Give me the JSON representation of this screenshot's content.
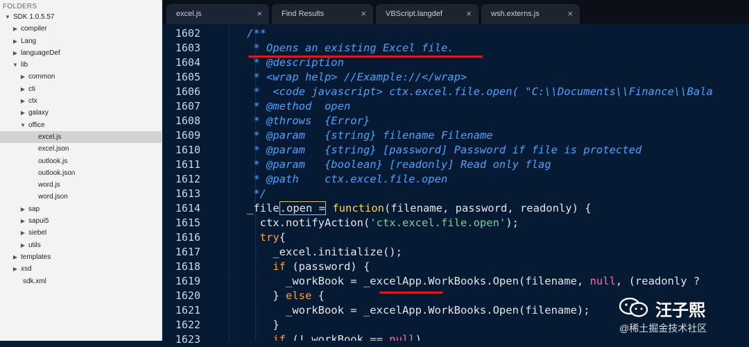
{
  "sidebar": {
    "header": "FOLDERS",
    "items": [
      {
        "label": "SDK 1.0.5.57",
        "arrow": "▼",
        "depth": 0
      },
      {
        "label": "compiler",
        "arrow": "▶",
        "depth": 1
      },
      {
        "label": "Lang",
        "arrow": "▶",
        "depth": 1
      },
      {
        "label": "languageDef",
        "arrow": "▶",
        "depth": 1
      },
      {
        "label": "lib",
        "arrow": "▼",
        "depth": 1
      },
      {
        "label": "common",
        "arrow": "▶",
        "depth": 2
      },
      {
        "label": "cti",
        "arrow": "▶",
        "depth": 2
      },
      {
        "label": "ctx",
        "arrow": "▶",
        "depth": 2
      },
      {
        "label": "galaxy",
        "arrow": "▶",
        "depth": 2
      },
      {
        "label": "office",
        "arrow": "▼",
        "depth": 2
      },
      {
        "label": "excel.js",
        "arrow": "",
        "depth": 3,
        "selected": true
      },
      {
        "label": "excel.json",
        "arrow": "",
        "depth": 3
      },
      {
        "label": "outlook.js",
        "arrow": "",
        "depth": 3
      },
      {
        "label": "outlook.json",
        "arrow": "",
        "depth": 3
      },
      {
        "label": "word.js",
        "arrow": "",
        "depth": 3
      },
      {
        "label": "word.json",
        "arrow": "",
        "depth": 3
      },
      {
        "label": "sap",
        "arrow": "▶",
        "depth": 2
      },
      {
        "label": "sapui5",
        "arrow": "▶",
        "depth": 2
      },
      {
        "label": "siebel",
        "arrow": "▶",
        "depth": 2
      },
      {
        "label": "utils",
        "arrow": "▶",
        "depth": 2
      },
      {
        "label": "templates",
        "arrow": "▶",
        "depth": 1
      },
      {
        "label": "xsd",
        "arrow": "▶",
        "depth": 1
      },
      {
        "label": "sdk.xml",
        "arrow": "",
        "depth": 1
      }
    ]
  },
  "tabs": [
    {
      "label": "excel.js",
      "close": "×"
    },
    {
      "label": "Find Results",
      "close": "×"
    },
    {
      "label": "VBScript.langdef",
      "close": "×"
    },
    {
      "label": "wsh.externs.js",
      "close": "×"
    }
  ],
  "line_numbers": [
    "1602",
    "1603",
    "1604",
    "1605",
    "1606",
    "1607",
    "1608",
    "1609",
    "1610",
    "1611",
    "1612",
    "1613",
    "1614",
    "1615",
    "1616",
    "1617",
    "1618",
    "1619",
    "1620",
    "1621",
    "1622",
    "1623"
  ],
  "code_lines": [
    [
      [
        "c",
        "      /**"
      ]
    ],
    [
      [
        "c",
        "       * Opens an existing Excel file."
      ]
    ],
    [
      [
        "c",
        "       * @description"
      ]
    ],
    [
      [
        "c",
        "       * <wrap help> //Example://</wrap>"
      ]
    ],
    [
      [
        "c",
        "       *  <code javascript> ctx.excel.file.open( \"C:\\\\Documents\\\\Finance\\\\Bala"
      ]
    ],
    [
      [
        "c",
        "       * @method  open"
      ]
    ],
    [
      [
        "c",
        "       * @throws  {Error}"
      ]
    ],
    [
      [
        "c",
        "       * @param   {string} filename Filename"
      ]
    ],
    [
      [
        "c",
        "       * @param   {string} [password] Password if file is protected"
      ]
    ],
    [
      [
        "c",
        "       * @param   {boolean} [readonly] Read only flag"
      ]
    ],
    [
      [
        "c",
        "       * @path    ctx.excel.file.open"
      ]
    ],
    [
      [
        "c",
        "       */"
      ]
    ],
    [
      [
        "t",
        "      _file"
      ],
      [
        "sel",
        ".open ="
      ],
      [
        "t",
        " "
      ],
      [
        "fn",
        "function"
      ],
      [
        "t",
        "(filename, password, readonly) {"
      ]
    ],
    [
      [
        "t",
        "        ctx.notifyAction("
      ],
      [
        "str",
        "'ctx.excel.file.open'"
      ],
      [
        "t",
        ");"
      ]
    ],
    [
      [
        "kw",
        "        try"
      ],
      [
        "t",
        "{"
      ]
    ],
    [
      [
        "t",
        "          _excel.initialize();"
      ]
    ],
    [
      [
        "kw",
        "          if"
      ],
      [
        "t",
        " (password) {"
      ]
    ],
    [
      [
        "t",
        "            _workBook = _excelApp.WorkBooks.Open(filename, "
      ],
      [
        "nul",
        "null"
      ],
      [
        "t",
        ", (readonly ?"
      ]
    ],
    [
      [
        "t",
        "          } "
      ],
      [
        "kw",
        "else"
      ],
      [
        "t",
        " {"
      ]
    ],
    [
      [
        "t",
        "            _workBook = _excelApp.WorkBooks.Open(filename);"
      ]
    ],
    [
      [
        "t",
        "          }"
      ]
    ],
    [
      [
        "kw",
        "          if"
      ],
      [
        "t",
        " (!_workBook == "
      ],
      [
        "nul",
        "null"
      ],
      [
        "t",
        ")"
      ]
    ]
  ],
  "watermark": {
    "name": "汪子熙",
    "sub": "@稀土掘金技术社区",
    "icon": "wechat-icon"
  }
}
